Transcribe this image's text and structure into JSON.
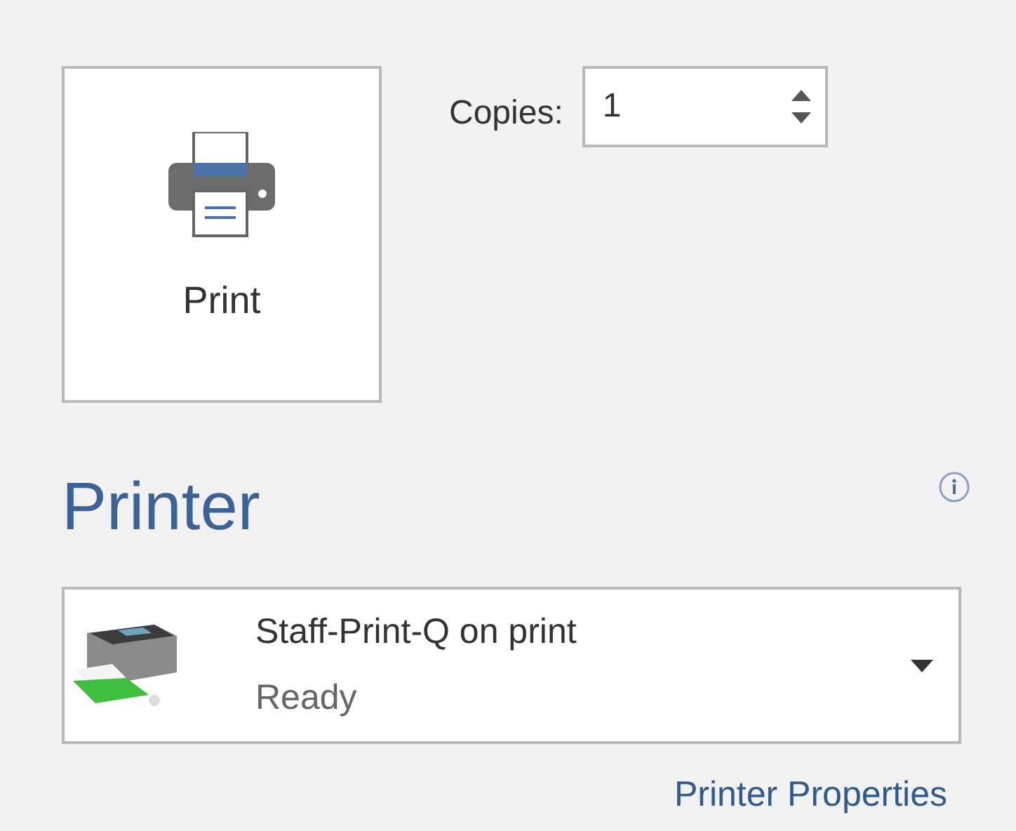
{
  "print_button": {
    "label": "Print"
  },
  "copies": {
    "label": "Copies:",
    "value": "1"
  },
  "printer_section": {
    "heading": "Printer"
  },
  "printer_dropdown": {
    "name": "Staff-Print-Q on print",
    "status": "Ready"
  },
  "printer_properties_link": "Printer Properties"
}
